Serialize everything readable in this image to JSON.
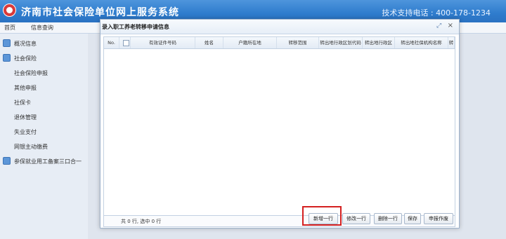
{
  "header": {
    "title": "济南市社会保险单位网上服务系统",
    "support": "技术支持电话 : 400-178-1234"
  },
  "topnav": {
    "tabs": [
      "首页",
      "信息查询"
    ]
  },
  "sidebar": {
    "items": [
      {
        "label": "概况信息",
        "icon": "home-icon"
      },
      {
        "label": "社会保险",
        "icon": "edit-icon"
      },
      {
        "label": "社会保险申报"
      },
      {
        "label": "其他申报"
      },
      {
        "label": "社保卡"
      },
      {
        "label": "退休管理"
      },
      {
        "label": "失业支付"
      },
      {
        "label": "网银主动缴费"
      },
      {
        "label": "参保就业用工备案三口合一",
        "icon": "edit-icon"
      }
    ]
  },
  "dialog": {
    "title": "录入职工养老转移申请信息",
    "columns": [
      "No.",
      "",
      "有效证件号码",
      "姓名",
      "户籍所在地",
      "转移范围",
      "转出地行政区划代码",
      "转出地行政区",
      "转出地社保机构名称",
      "转"
    ],
    "footer": "共 0 行, 选中 0 行",
    "buttons": [
      "新增一行",
      "修改一行",
      "删除一行",
      "保存",
      "申报作废"
    ]
  },
  "colors": {
    "header_bg": "#2f7ccd",
    "highlight": "#d42020"
  }
}
